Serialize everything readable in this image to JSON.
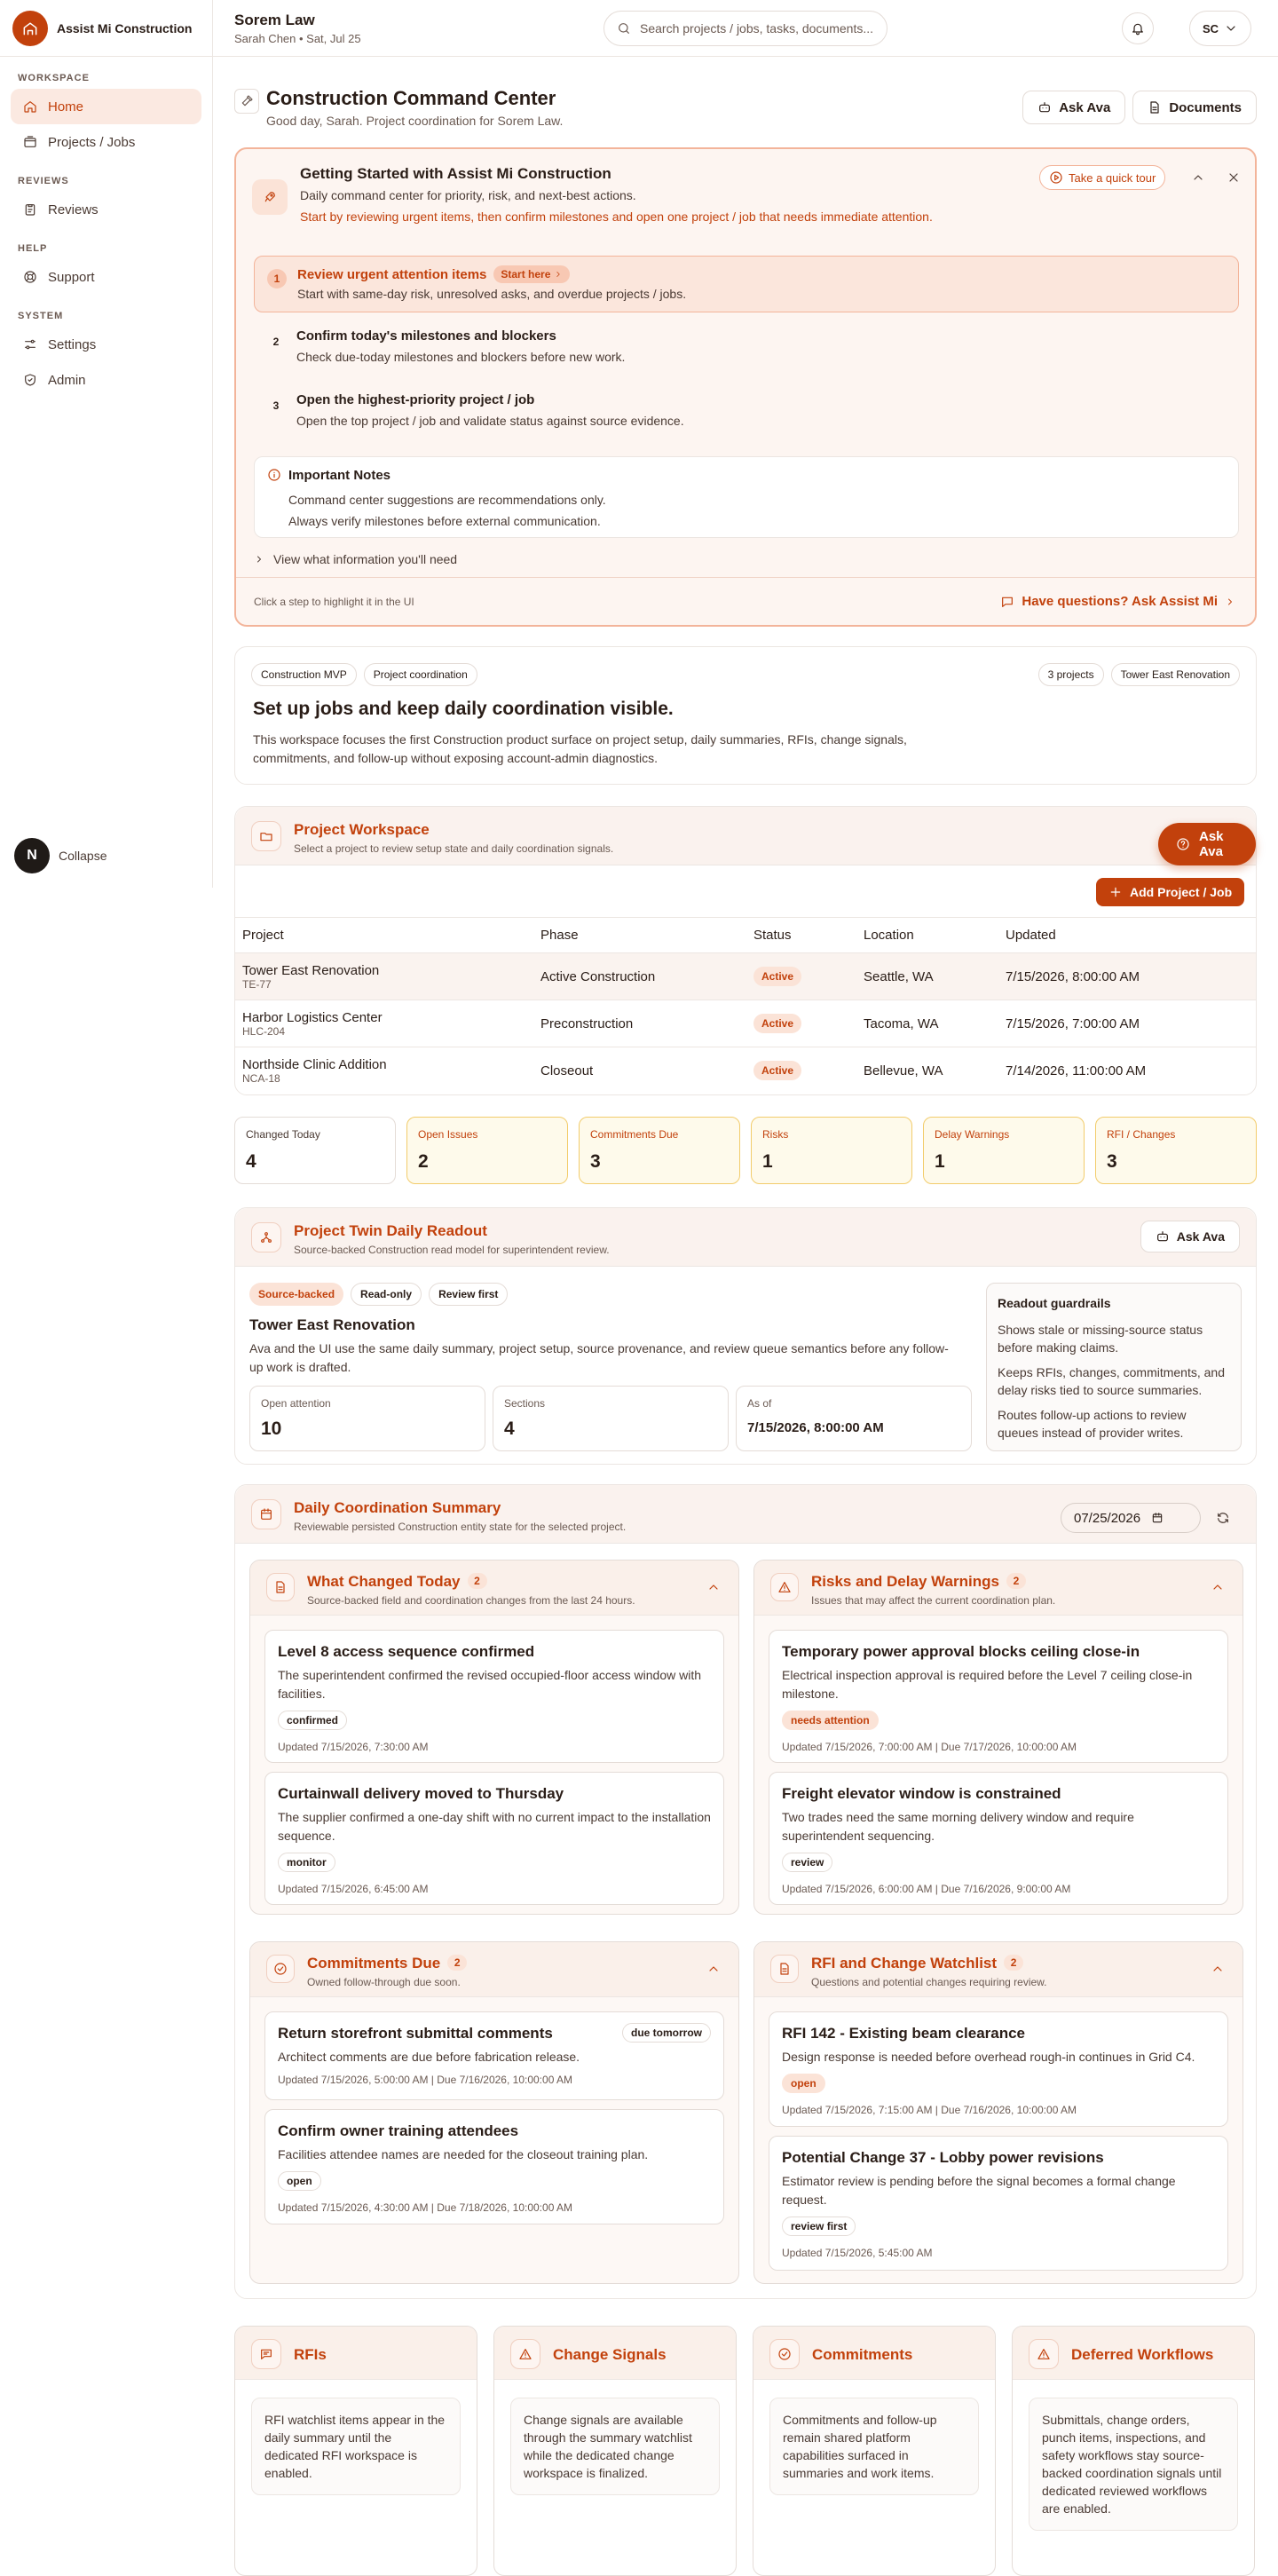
{
  "brand": {
    "name": "Assist Mi Construction"
  },
  "sidebar": {
    "groups": [
      {
        "label": "WORKSPACE",
        "items": [
          {
            "label": "Home",
            "icon": "home-icon"
          },
          {
            "label": "Projects / Jobs",
            "icon": "folder-icon"
          }
        ]
      },
      {
        "label": "REVIEWS",
        "items": [
          {
            "label": "Reviews",
            "icon": "clipboard-icon"
          }
        ]
      },
      {
        "label": "HELP",
        "items": [
          {
            "label": "Support",
            "icon": "lifebuoy-icon"
          }
        ]
      },
      {
        "label": "SYSTEM",
        "items": [
          {
            "label": "Settings",
            "icon": "sliders-icon"
          },
          {
            "label": "Admin",
            "icon": "shield-icon"
          }
        ]
      }
    ],
    "collapse_label": "Collapse",
    "avatar_letter": "N"
  },
  "topbar": {
    "org": "Sorem Law",
    "subtitle": "Sarah Chen • Sat, Jul 25",
    "search_placeholder": "Search projects / jobs, tasks, documents...",
    "user_initials": "SC"
  },
  "page": {
    "title": "Construction Command Center",
    "subtitle": "Good day, Sarah. Project coordination for Sorem Law.",
    "ask_ava": "Ask Ava",
    "documents": "Documents"
  },
  "onboarding": {
    "title": "Getting Started with Assist Mi Construction",
    "sub1": "Daily command center for priority, risk, and next-best actions.",
    "sub2": "Start by reviewing urgent items, then confirm milestones and open one project / job that needs immediate attention.",
    "tour": "Take a quick tour",
    "steps": [
      {
        "num": "1",
        "title": "Review urgent attention items",
        "desc": "Start with same-day risk, unresolved asks, and overdue projects / jobs."
      },
      {
        "num": "2",
        "title": "Confirm today's milestones and blockers",
        "desc": "Check due-today milestones and blockers before new work."
      },
      {
        "num": "3",
        "title": "Open the highest-priority project / job",
        "desc": "Open the top project / job and validate status against source evidence."
      }
    ],
    "start_here": "Start here",
    "notes_title": "Important Notes",
    "notes": [
      "Command center suggestions are recommendations only.",
      "Always verify milestones before external communication."
    ],
    "view_info": "View what information you'll need",
    "hint": "Click a step to highlight it in the UI",
    "ask_question": "Have questions? Ask Assist Mi"
  },
  "setup": {
    "pills": [
      "Construction MVP",
      "Project coordination"
    ],
    "right_pills": [
      "3 projects",
      "Tower East Renovation"
    ],
    "title": "Set up jobs and keep daily coordination visible.",
    "desc": "This workspace focuses the first Construction product surface on project setup, daily summaries, RFIs, change signals, commitments, and follow-up without exposing account-admin diagnostics."
  },
  "workspace": {
    "title": "Project Workspace",
    "subtitle": "Select a project to review setup state and daily coordination signals.",
    "ask_ava": "Ask Ava",
    "add_button": "Add Project / Job",
    "columns": [
      "Project",
      "Phase",
      "Status",
      "Location",
      "Updated"
    ],
    "rows": [
      {
        "name": "Tower East Renovation",
        "code": "TE-77",
        "phase": "Active Construction",
        "status": "Active",
        "location": "Seattle, WA",
        "updated": "7/15/2026, 8:00:00 AM"
      },
      {
        "name": "Harbor Logistics Center",
        "code": "HLC-204",
        "phase": "Preconstruction",
        "status": "Active",
        "location": "Tacoma, WA",
        "updated": "7/15/2026, 7:00:00 AM"
      },
      {
        "name": "Northside Clinic Addition",
        "code": "NCA-18",
        "phase": "Closeout",
        "status": "Active",
        "location": "Bellevue, WA",
        "updated": "7/14/2026, 11:00:00 AM"
      }
    ]
  },
  "metrics": [
    {
      "label": "Changed Today",
      "value": "4",
      "warn": false
    },
    {
      "label": "Open Issues",
      "value": "2",
      "warn": true
    },
    {
      "label": "Commitments Due",
      "value": "3",
      "warn": true
    },
    {
      "label": "Risks",
      "value": "1",
      "warn": true
    },
    {
      "label": "Delay Warnings",
      "value": "1",
      "warn": true
    },
    {
      "label": "RFI / Changes",
      "value": "3",
      "warn": true
    }
  ],
  "twin": {
    "title": "Project Twin Daily Readout",
    "subtitle": "Source-backed Construction read model for superintendent review.",
    "ask_ava": "Ask Ava",
    "chips": [
      "Source-backed",
      "Read-only",
      "Review first"
    ],
    "project": "Tower East Renovation",
    "desc": "Ava and the UI use the same daily summary, project setup, source provenance, and review queue semantics before any follow-up work is drafted.",
    "stats": [
      {
        "label": "Open attention",
        "value": "10"
      },
      {
        "label": "Sections",
        "value": "4"
      },
      {
        "label": "As of",
        "value": "7/15/2026, 8:00:00 AM"
      }
    ],
    "guard_title": "Readout guardrails",
    "guards": [
      "Shows stale or missing-source status before making claims.",
      "Keeps RFIs, changes, commitments, and delay risks tied to source summaries.",
      "Routes follow-up actions to review queues instead of provider writes."
    ]
  },
  "daily": {
    "title": "Daily Coordination Summary",
    "subtitle": "Reviewable persisted Construction entity state for the selected project.",
    "date": "07/25/2026",
    "panels": [
      {
        "title": "What Changed Today",
        "count": "2",
        "sub": "Source-backed field and coordination changes from the last 24 hours.",
        "items": [
          {
            "title": "Level 8 access sequence confirmed",
            "desc": "The superintendent confirmed the revised occupied-floor access window with facilities.",
            "tag": "confirmed",
            "meta": "Updated 7/15/2026, 7:30:00 AM"
          },
          {
            "title": "Curtainwall delivery moved to Thursday",
            "desc": "The supplier confirmed a one-day shift with no current impact to the installation sequence.",
            "tag": "monitor",
            "meta": "Updated 7/15/2026, 6:45:00 AM"
          }
        ]
      },
      {
        "title": "Risks and Delay Warnings",
        "count": "2",
        "sub": "Issues that may affect the current coordination plan.",
        "items": [
          {
            "title": "Temporary power approval blocks ceiling close-in",
            "desc": "Electrical inspection approval is required before the Level 7 ceiling close-in milestone.",
            "tag": "needs attention",
            "meta": "Updated 7/15/2026, 7:00:00 AM | Due 7/17/2026, 10:00:00 AM"
          },
          {
            "title": "Freight elevator window is constrained",
            "desc": "Two trades need the same morning delivery window and require superintendent sequencing.",
            "tag": "review",
            "meta": "Updated 7/15/2026, 6:00:00 AM | Due 7/16/2026, 9:00:00 AM"
          }
        ]
      },
      {
        "title": "Commitments Due",
        "count": "2",
        "sub": "Owned follow-through due soon.",
        "items": [
          {
            "title": "Return storefront submittal comments",
            "desc": "Architect comments are due before fabrication release.",
            "tag": "due tomorrow",
            "meta": "Updated 7/15/2026, 5:00:00 AM | Due 7/16/2026, 10:00:00 AM"
          },
          {
            "title": "Confirm owner training attendees",
            "desc": "Facilities attendee names are needed for the closeout training plan.",
            "tag": "open",
            "meta": "Updated 7/15/2026, 4:30:00 AM | Due 7/18/2026, 10:00:00 AM"
          }
        ]
      },
      {
        "title": "RFI and Change Watchlist",
        "count": "2",
        "sub": "Questions and potential changes requiring review.",
        "items": [
          {
            "title": "RFI 142 - Existing beam clearance",
            "desc": "Design response is needed before overhead rough-in continues in Grid C4.",
            "tag": "open",
            "meta": "Updated 7/15/2026, 7:15:00 AM | Due 7/16/2026, 10:00:00 AM"
          },
          {
            "title": "Potential Change 37 - Lobby power revisions",
            "desc": "Estimator review is pending before the signal becomes a formal change request.",
            "tag": "review first",
            "meta": "Updated 7/15/2026, 5:45:00 AM"
          }
        ]
      }
    ]
  },
  "bottom_cards": [
    {
      "title": "RFIs",
      "body": "RFI watchlist items appear in the daily summary until the dedicated RFI workspace is enabled."
    },
    {
      "title": "Change Signals",
      "body": "Change signals are available through the summary watchlist while the dedicated change workspace is finalized."
    },
    {
      "title": "Commitments",
      "body": "Commitments and follow-up remain shared platform capabilities surfaced in summaries and work items."
    },
    {
      "title": "Deferred Workflows",
      "body": "Submittals, change orders, punch items, inspections, and safety workflows stay source-backed coordination signals until dedicated reviewed workflows are enabled."
    }
  ]
}
